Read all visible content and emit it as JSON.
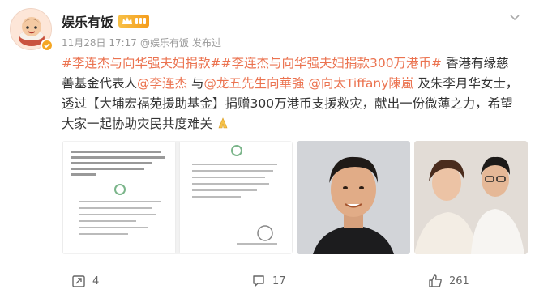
{
  "post": {
    "author": "娱乐有饭",
    "time": "11月28日 17:17",
    "source": "@娱乐有饭",
    "published": "发布过",
    "menu_icon": "chevron-down-icon",
    "text": {
      "topic1": "#李连杰与向华强夫妇捐款#",
      "topic2": "#李连杰与向华强夫妇捐款300万港币#",
      "part1": " 香港有缘慈善基金代表人",
      "mention1": "@李连杰",
      "part2": " 与",
      "mention2": "@龙五先生向華強",
      "part3": " ",
      "mention3": "@向太Tiffany陳嵐",
      "part4": " 及朱李月华女士，透过【大埔宏福苑援助基金】捐赠300万港币支援救灾，献出一份微薄之力，希望大家一起协助灾民共度难关",
      "emoji": "folded-hands-icon"
    },
    "images": [
      {
        "name": "document-image",
        "kind": "document"
      },
      {
        "name": "jet-li-photo",
        "kind": "photo"
      },
      {
        "name": "couple-photo",
        "kind": "photo"
      }
    ],
    "actions": {
      "reposts": "4",
      "comments": "17",
      "likes": "261"
    },
    "colors": {
      "link": "#eb7350",
      "vip_gold": "#f5a623"
    }
  }
}
